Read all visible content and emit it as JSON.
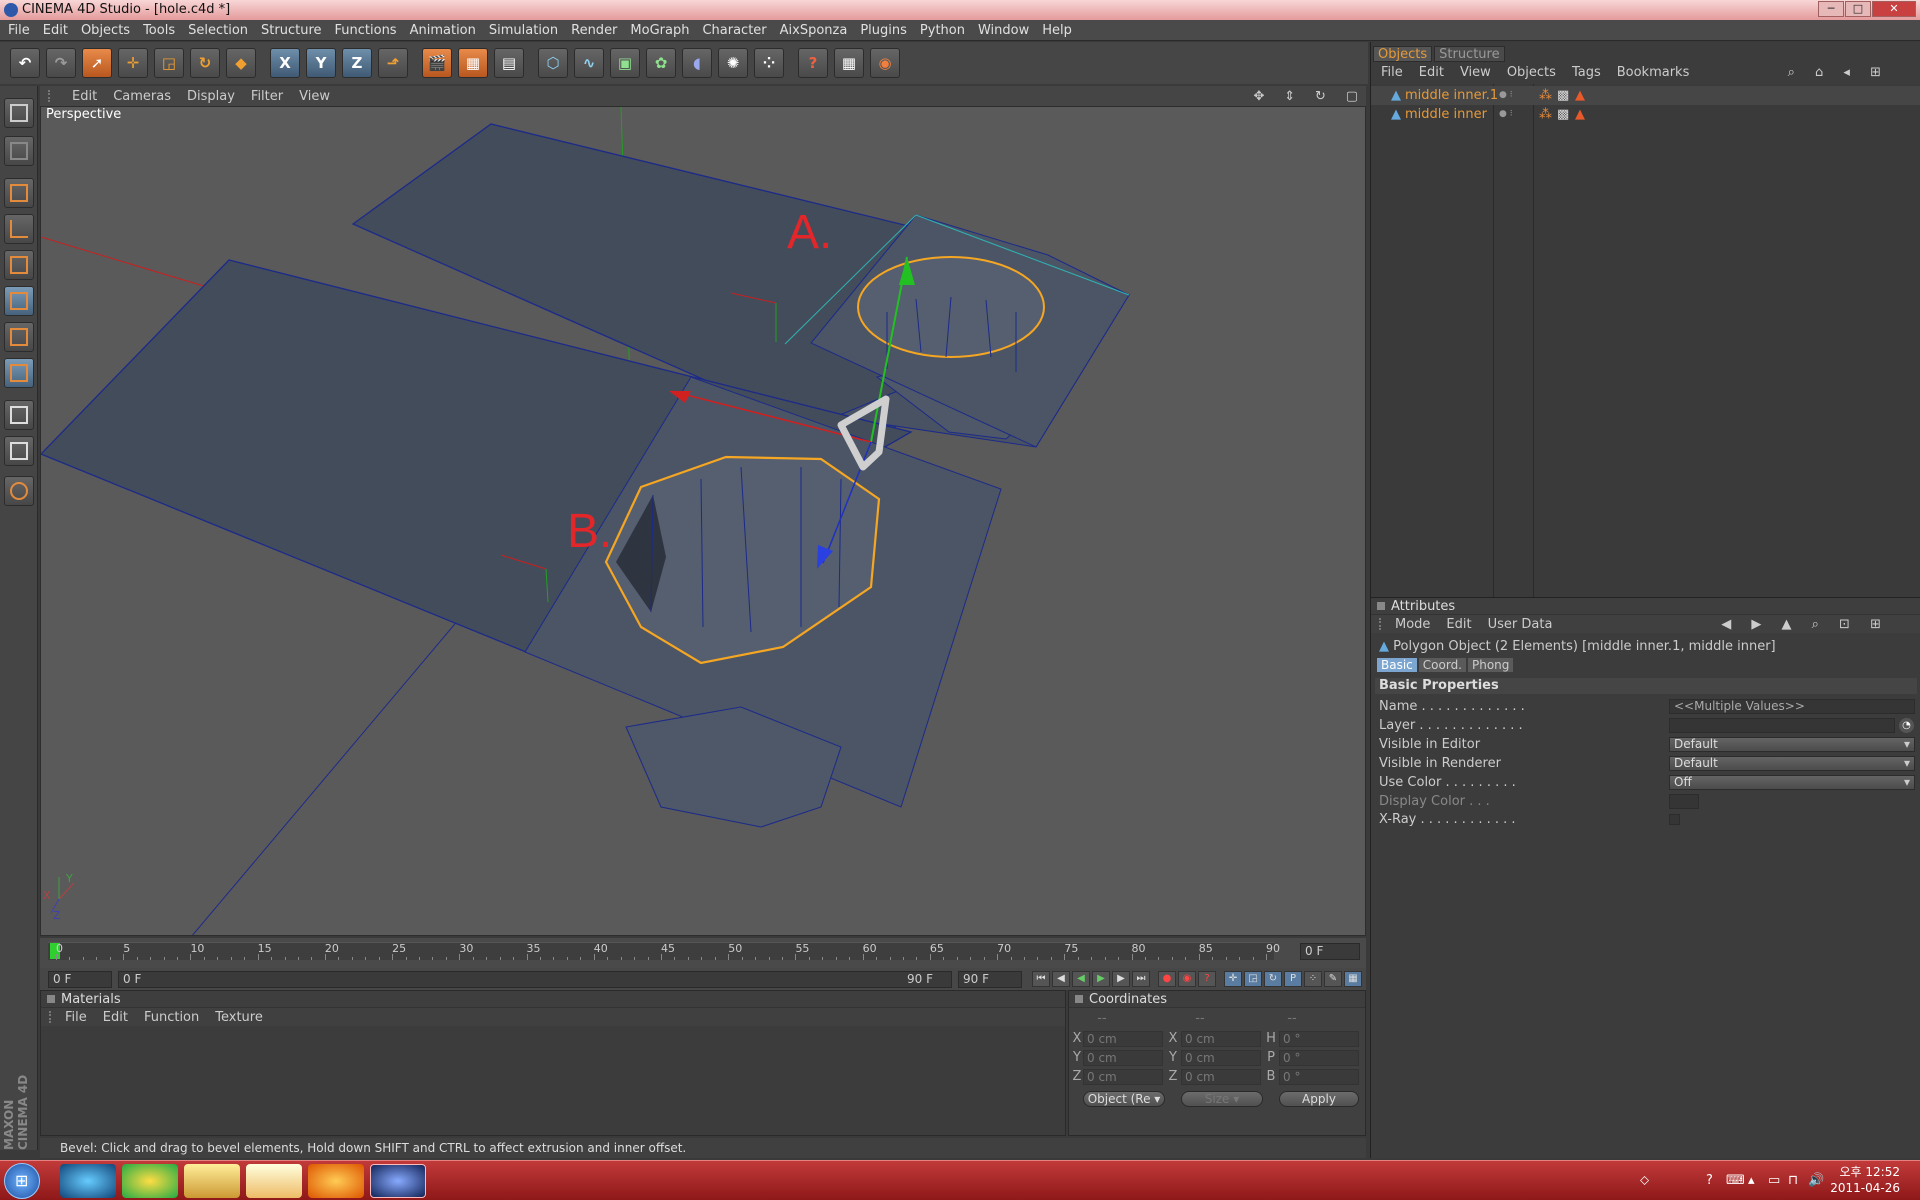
{
  "window": {
    "title": "CINEMA 4D Studio - [hole.c4d *]"
  },
  "menu": [
    "File",
    "Edit",
    "Objects",
    "Tools",
    "Selection",
    "Structure",
    "Functions",
    "Animation",
    "Simulation",
    "Render",
    "MoGraph",
    "Character",
    "AixSponza",
    "Plugins",
    "Python",
    "Window",
    "Help"
  ],
  "toolbar_axes": [
    "X",
    "Y",
    "Z"
  ],
  "viewport": {
    "menu": [
      "Edit",
      "Cameras",
      "Display",
      "Filter",
      "View"
    ],
    "label": "Perspective",
    "annotation_a": "A.",
    "annotation_b": "B.",
    "axis_x": "X",
    "axis_y": "Y",
    "axis_z": "Z",
    "colors": {
      "background": "#5a5a5a",
      "mesh": "#434c5a",
      "edge": "#1c2a8a",
      "selection": "#f5a623",
      "annotation": "#e3262a"
    }
  },
  "timeline": {
    "ticks": [
      "0",
      "5",
      "10",
      "15",
      "20",
      "25",
      "30",
      "35",
      "40",
      "45",
      "50",
      "55",
      "60",
      "65",
      "70",
      "75",
      "80",
      "85",
      "90"
    ],
    "current_frame": "0 F",
    "start_frame": "0 F",
    "range_start": "0 F",
    "range_end": "90 F",
    "end_frame": "90 F"
  },
  "materials": {
    "title": "Materials",
    "menu": [
      "File",
      "Edit",
      "Function",
      "Texture"
    ]
  },
  "coordinates": {
    "title": "Coordinates",
    "headers": [
      "--",
      "--",
      "--"
    ],
    "rows": [
      {
        "l1": "X",
        "v1": "0 cm",
        "l2": "X",
        "v2": "0 cm",
        "l3": "H",
        "v3": "0 °"
      },
      {
        "l1": "Y",
        "v1": "0 cm",
        "l2": "Y",
        "v2": "0 cm",
        "l3": "P",
        "v3": "0 °"
      },
      {
        "l1": "Z",
        "v1": "0 cm",
        "l2": "Z",
        "v2": "0 cm",
        "l3": "B",
        "v3": "0 °"
      }
    ],
    "mode_select": "Object (Re",
    "size_select": "Size",
    "apply": "Apply"
  },
  "status": "Bevel: Click and drag to bevel elements, Hold down SHIFT and CTRL to affect extrusion and inner offset.",
  "brand": "MAXON CINEMA 4D",
  "objects_panel": {
    "tabs": [
      "Objects",
      "Structure"
    ],
    "menu": [
      "File",
      "Edit",
      "View",
      "Objects",
      "Tags",
      "Bookmarks"
    ],
    "items": [
      "middle inner.1",
      "middle inner"
    ]
  },
  "attributes": {
    "title": "Attributes",
    "menu": [
      "Mode",
      "Edit",
      "User Data"
    ],
    "object_line": "Polygon Object (2 Elements) [middle inner.1, middle inner]",
    "tabs": [
      "Basic",
      "Coord.",
      "Phong"
    ],
    "section": "Basic Properties",
    "fields": [
      {
        "label": "Name . . . . . . . . . . . . .",
        "value": "<<Multiple Values>>"
      },
      {
        "label": "Layer . . . . . . . . . . . . .",
        "value": ""
      },
      {
        "label": "Visible in Editor",
        "value": "Default"
      },
      {
        "label": "Visible in Renderer",
        "value": "Default"
      },
      {
        "label": "Use Color . . . . . . . . .",
        "value": "Off"
      },
      {
        "label": "Display Color . . .",
        "value": ""
      },
      {
        "label": "X-Ray . . . . . . . . . . . .",
        "value": ""
      }
    ]
  },
  "taskbar": {
    "time": "오후 12:52",
    "date": "2011-04-26"
  }
}
